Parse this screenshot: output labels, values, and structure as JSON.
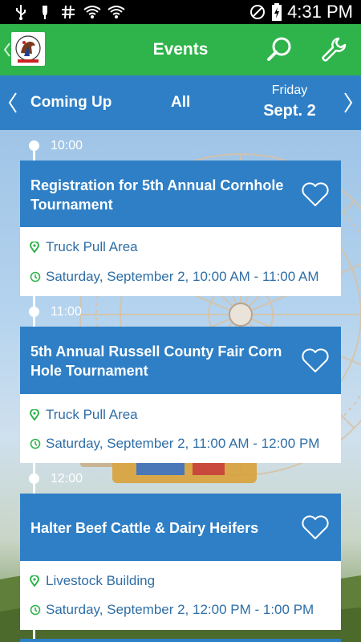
{
  "status_bar": {
    "time": "4:31 PM",
    "icons": [
      "usb-icon",
      "usb-icon",
      "hash-icon",
      "wifi-icon",
      "wifi-icon",
      "do-not-disturb-icon",
      "battery-charging-icon"
    ]
  },
  "app_bar": {
    "title": "Events",
    "icons": {
      "back": "chevron-left-icon",
      "logo": "fair-logo",
      "search": "search-icon",
      "settings": "wrench-icon"
    },
    "color": "#2fb34b"
  },
  "date_nav": {
    "tabs": [
      "Coming Up",
      "All"
    ],
    "day_name": "Friday",
    "day_date": "Sept. 2",
    "color": "#2e7fc6"
  },
  "timeline": [
    {
      "time": "10:00",
      "event": {
        "title": "Registration for 5th Annual Cornhole Tournament",
        "location": "Truck Pull Area",
        "datetime": "Saturday, September 2, 10:00 AM - 11:00 AM",
        "favorite": false
      }
    },
    {
      "time": "11:00",
      "event": {
        "title": "5th Annual Russell County Fair Corn Hole Tournament",
        "location": "Truck Pull Area",
        "datetime": "Saturday, September 2, 11:00 AM - 12:00 PM",
        "favorite": false
      }
    },
    {
      "time": "12:00",
      "event": {
        "title": "Halter Beef Cattle & Dairy Heifers",
        "location": "Livestock Building",
        "datetime": "Saturday, September 2, 12:00 PM - 1:00 PM",
        "favorite": false
      }
    }
  ],
  "colors": {
    "accent_blue": "#2e7fc6",
    "accent_green": "#2fb34b",
    "location_pin": "#2fb34b",
    "text_link": "#2e6ea6"
  }
}
